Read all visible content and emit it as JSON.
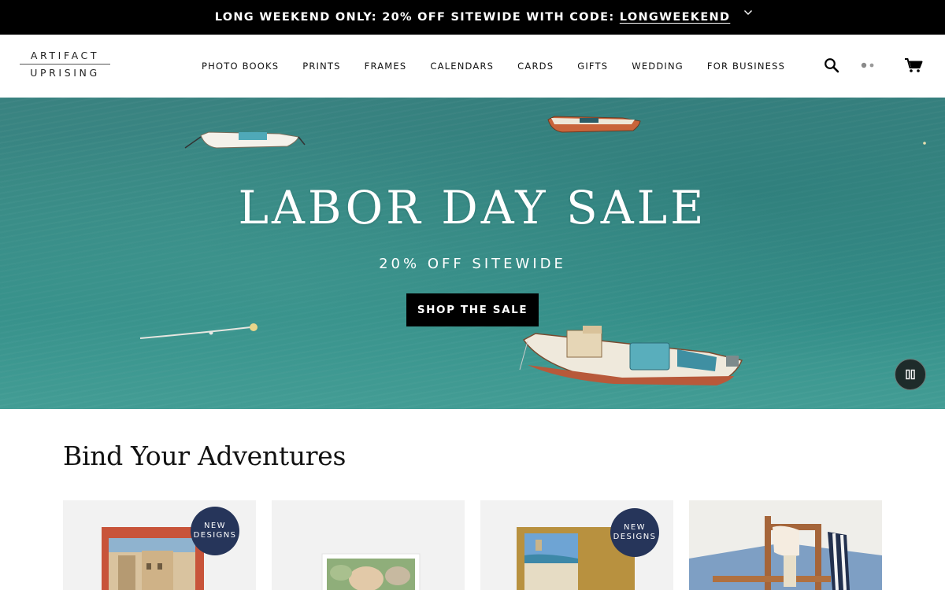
{
  "promo": {
    "text": "LONG WEEKEND ONLY: 20% OFF SITEWIDE WITH CODE: ",
    "code": "LONGWEEKEND",
    "toggle_icon": "chevron-down-icon"
  },
  "header": {
    "logo_top": "ARTIFACT",
    "logo_bottom": "UPRISING",
    "nav": [
      "PHOTO BOOKS",
      "PRINTS",
      "FRAMES",
      "CALENDARS",
      "CARDS",
      "GIFTS",
      "WEDDING",
      "FOR BUSINESS"
    ],
    "icons": [
      "search-icon",
      "account-icon",
      "cart-icon"
    ]
  },
  "hero": {
    "title": "LABOR DAY SALE",
    "subtitle": "20% OFF SITEWIDE",
    "cta": "SHOP THE SALE",
    "pause_icon": "pause-icon"
  },
  "section": {
    "title": "Bind Your Adventures",
    "cards": [
      {
        "badge_line1": "NEW",
        "badge_line2": "DESIGNS"
      },
      {},
      {
        "badge_line1": "NEW",
        "badge_line2": "DESIGNS"
      },
      {}
    ]
  },
  "colors": {
    "promo_bg": "#000000",
    "cta_bg": "#000000",
    "badge_bg": "#26355a",
    "sea": "#3e948e"
  }
}
